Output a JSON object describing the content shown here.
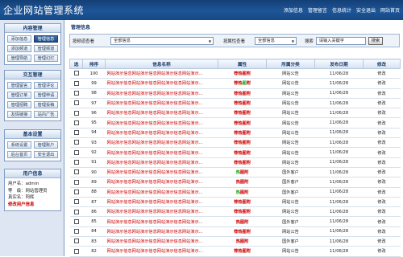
{
  "header": {
    "title": "企业网站管理系统",
    "nav": [
      "添加信息",
      "管理留言",
      "信息统计",
      "安全退出",
      "网站首页"
    ]
  },
  "sidebar": {
    "sections": [
      {
        "title": "内容管理",
        "items": [
          {
            "label": "添加信息",
            "active": false
          },
          {
            "label": "管理信息",
            "active": true
          },
          {
            "label": "添加频道",
            "active": false
          },
          {
            "label": "管理频道",
            "active": false
          },
          {
            "label": "管理导航",
            "active": false
          },
          {
            "label": "管理幻灯",
            "active": false
          }
        ]
      },
      {
        "title": "交互管理",
        "items": [
          {
            "label": "管理留言"
          },
          {
            "label": "管理评论"
          },
          {
            "label": "管理订单"
          },
          {
            "label": "管理申请"
          },
          {
            "label": "管理招聘"
          },
          {
            "label": "管理投稿"
          },
          {
            "label": "友情链接"
          },
          {
            "label": "站内广告"
          }
        ]
      },
      {
        "title": "基本设置",
        "items": [
          {
            "label": "系统设置"
          },
          {
            "label": "管理账户"
          },
          {
            "label": "后台首页"
          },
          {
            "label": "安全退出"
          }
        ]
      }
    ],
    "user": {
      "title": "用户信息",
      "lines": [
        "用户名：admin",
        "等　级：网站管理员",
        "真实名：阿辉"
      ],
      "warning": "修改用户信息"
    }
  },
  "main": {
    "title": "管理信息",
    "filter": {
      "by_type_label": "按频道查看",
      "by_type_value": "全部信息",
      "by_attr_label": "按属性查看",
      "by_attr_value": "全部信息",
      "search_label": "搜索",
      "search_placeholder": "请输入关键字",
      "search_button": "搜索"
    },
    "columns": [
      "选",
      "排序",
      "信息名称",
      "属性",
      "所属分类",
      "发布日期",
      "修改"
    ],
    "rows": [
      {
        "order": "100",
        "title": "网站演示信息网站演示信息网站演示信息网站演示...",
        "attr": [
          {
            "t": "荐",
            "c": "r"
          },
          {
            "t": "热",
            "c": "r"
          },
          {
            "t": "图",
            "c": "r"
          },
          {
            "t": "附",
            "c": "r"
          }
        ],
        "cat": "网站公告",
        "date": "11/06/28",
        "edit": "修改"
      },
      {
        "order": "99",
        "title": "网站演示信息网站演示信息网站演示信息网站演示...",
        "attr": [
          {
            "t": "荐",
            "c": "r"
          },
          {
            "t": "热",
            "c": "r"
          },
          {
            "t": "图",
            "c": "g"
          },
          {
            "t": "附",
            "c": "r"
          }
        ],
        "cat": "网站公告",
        "date": "11/06/28",
        "edit": "修改"
      },
      {
        "order": "98",
        "title": "网站演示信息网站演示信息网站演示信息网站演示...",
        "attr": [
          {
            "t": "荐",
            "c": "r"
          },
          {
            "t": "热",
            "c": "r"
          },
          {
            "t": "图",
            "c": "r"
          },
          {
            "t": "附",
            "c": "r"
          }
        ],
        "cat": "网站公告",
        "date": "11/06/28",
        "edit": "修改"
      },
      {
        "order": "97",
        "title": "网站演示信息网站演示信息网站演示信息网站演示...",
        "attr": [
          {
            "t": "荐",
            "c": "r"
          },
          {
            "t": "热",
            "c": "r"
          },
          {
            "t": "图",
            "c": "r"
          },
          {
            "t": "附",
            "c": "r"
          }
        ],
        "cat": "网站公告",
        "date": "11/06/28",
        "edit": "修改"
      },
      {
        "order": "96",
        "title": "网站演示信息网站演示信息网站演示信息网站演示...",
        "attr": [
          {
            "t": "荐",
            "c": "r"
          },
          {
            "t": "热",
            "c": "r"
          },
          {
            "t": "图",
            "c": "r"
          },
          {
            "t": "附",
            "c": "r"
          }
        ],
        "cat": "网站公告",
        "date": "11/06/28",
        "edit": "修改"
      },
      {
        "order": "95",
        "title": "网站演示信息网站演示信息网站演示信息网站演示...",
        "attr": [
          {
            "t": "荐",
            "c": "r"
          },
          {
            "t": "热",
            "c": "r"
          },
          {
            "t": "图",
            "c": "r"
          },
          {
            "t": "附",
            "c": "r"
          }
        ],
        "cat": "网站公告",
        "date": "11/06/28",
        "edit": "修改"
      },
      {
        "order": "94",
        "title": "网站演示信息网站演示信息网站演示信息网站演示...",
        "attr": [
          {
            "t": "荐",
            "c": "r"
          },
          {
            "t": "热",
            "c": "r"
          },
          {
            "t": "图",
            "c": "r"
          },
          {
            "t": "附",
            "c": "r"
          }
        ],
        "cat": "网站公告",
        "date": "11/06/28",
        "edit": "修改"
      },
      {
        "order": "93",
        "title": "网站演示信息网站演示信息网站演示信息网站演示...",
        "attr": [
          {
            "t": "荐",
            "c": "r"
          },
          {
            "t": "热",
            "c": "r"
          },
          {
            "t": "图",
            "c": "r"
          },
          {
            "t": "附",
            "c": "r"
          }
        ],
        "cat": "网站公告",
        "date": "11/06/28",
        "edit": "修改"
      },
      {
        "order": "92",
        "title": "网站演示信息网站演示信息网站演示信息网站演示...",
        "attr": [
          {
            "t": "荐",
            "c": "r"
          },
          {
            "t": "热",
            "c": "r"
          },
          {
            "t": "图",
            "c": "r"
          },
          {
            "t": "附",
            "c": "r"
          }
        ],
        "cat": "网站公告",
        "date": "11/06/28",
        "edit": "修改"
      },
      {
        "order": "91",
        "title": "网站演示信息网站演示信息网站演示信息网站演示...",
        "attr": [
          {
            "t": "荐",
            "c": "r"
          },
          {
            "t": "热",
            "c": "r"
          },
          {
            "t": "图",
            "c": "r"
          },
          {
            "t": "附",
            "c": "r"
          }
        ],
        "cat": "网站公告",
        "date": "11/06/28",
        "edit": "修改"
      },
      {
        "order": "90",
        "title": "网站演示信息网站演示信息网站演示信息网站演示...",
        "attr": [
          {
            "t": "热",
            "c": "g"
          },
          {
            "t": "图",
            "c": "r"
          },
          {
            "t": "附",
            "c": "r"
          }
        ],
        "cat": "国外客户",
        "date": "11/06/28",
        "edit": "修改"
      },
      {
        "order": "89",
        "title": "网站演示信息网站演示信息网站演示信息网站演示...",
        "attr": [
          {
            "t": "热",
            "c": "r"
          },
          {
            "t": "图",
            "c": "r"
          },
          {
            "t": "附",
            "c": "r"
          }
        ],
        "cat": "国外客户",
        "date": "11/06/28",
        "edit": "修改"
      },
      {
        "order": "88",
        "title": "网站演示信息网站演示信息网站演示信息网站演示...",
        "attr": [
          {
            "t": "热",
            "c": "g"
          },
          {
            "t": "图",
            "c": "r"
          },
          {
            "t": "附",
            "c": "r"
          }
        ],
        "cat": "国外客户",
        "date": "11/06/28",
        "edit": "修改"
      },
      {
        "order": "87",
        "title": "网站演示信息网站演示信息网站演示信息网站演示...",
        "attr": [
          {
            "t": "荐",
            "c": "r"
          },
          {
            "t": "热",
            "c": "r"
          },
          {
            "t": "图",
            "c": "r"
          },
          {
            "t": "附",
            "c": "r"
          }
        ],
        "cat": "网站公告",
        "date": "11/06/28",
        "edit": "修改"
      },
      {
        "order": "86",
        "title": "网站演示信息网站演示信息网站演示信息网站演示...",
        "attr": [
          {
            "t": "荐",
            "c": "r"
          },
          {
            "t": "热",
            "c": "r"
          },
          {
            "t": "图",
            "c": "r"
          },
          {
            "t": "附",
            "c": "r"
          }
        ],
        "cat": "网站公告",
        "date": "11/06/28",
        "edit": "修改"
      },
      {
        "order": "85",
        "title": "网站演示信息网站演示信息网站演示信息网站演示...",
        "attr": [
          {
            "t": "热",
            "c": "r"
          },
          {
            "t": "图",
            "c": "r"
          },
          {
            "t": "附",
            "c": "r"
          }
        ],
        "cat": "国外客户",
        "date": "11/06/28",
        "edit": "修改"
      },
      {
        "order": "84",
        "title": "网站演示信息网站演示信息网站演示信息网站演示...",
        "attr": [
          {
            "t": "荐",
            "c": "r"
          },
          {
            "t": "热",
            "c": "r"
          },
          {
            "t": "图",
            "c": "r"
          },
          {
            "t": "附",
            "c": "r"
          }
        ],
        "cat": "网站公告",
        "date": "11/06/28",
        "edit": "修改"
      },
      {
        "order": "83",
        "title": "网站演示信息网站演示信息网站演示信息网站演示...",
        "attr": [
          {
            "t": "热",
            "c": "r"
          },
          {
            "t": "图",
            "c": "r"
          },
          {
            "t": "附",
            "c": "r"
          }
        ],
        "cat": "国外客户",
        "date": "11/06/28",
        "edit": "修改"
      },
      {
        "order": "82",
        "title": "网站演示信息网站演示信息网站演示信息网站演示...",
        "attr": [
          {
            "t": "荐",
            "c": "r"
          },
          {
            "t": "热",
            "c": "r"
          },
          {
            "t": "图",
            "c": "r"
          },
          {
            "t": "附",
            "c": "r"
          }
        ],
        "cat": "网站公告",
        "date": "11/06/28",
        "edit": "修改"
      }
    ]
  }
}
